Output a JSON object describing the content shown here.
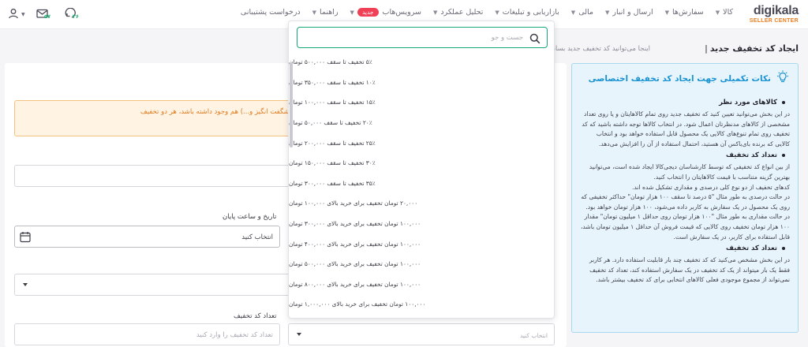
{
  "brand": {
    "name": "digikala",
    "sub": "SELLER CENTER"
  },
  "nav": [
    {
      "label": "کالا",
      "has_menu": true
    },
    {
      "label": "سفارش‌ها",
      "has_menu": true
    },
    {
      "label": "ارسال و انبار",
      "has_menu": true
    },
    {
      "label": "مالی",
      "has_menu": true
    },
    {
      "label": "بازاریابی و تبلیغات",
      "has_menu": true
    },
    {
      "label": "تحلیل عملکرد",
      "has_menu": true
    },
    {
      "label": "سرویس‌هاب",
      "has_menu": true,
      "badge": "جدید"
    },
    {
      "label": "راهنما",
      "has_menu": true
    },
    {
      "label": "درخواست پشتیبانی",
      "has_menu": false
    }
  ],
  "top_icons": {
    "messages_count": "۵۷",
    "notifications_count": "۲۶"
  },
  "page": {
    "title": "ایجاد کد تخفیف جدید",
    "separator": "|",
    "subtitle": "اینجا می‌توانید کد تخفیف جدید بسازید."
  },
  "tips": {
    "title": "نکات تکمیلی جهت ایجاد کد تخفیف اختصاصی",
    "sections": [
      {
        "heading": "کالاهای مورد نظر",
        "paragraphs": [
          "در این بخش می‌توانید تعیین کنید که تخفیف جدید روی تمام کالاهایتان و یا روی تعداد مشخصی از کالاهای مدنظرتان اعمال شود. در انتخاب کالاها توجه داشته باشید که کد تخفیف روی تمام تنوع‌های کالایی یک محصول قابل استفاده خواهد بود و انتخاب کالایی که برنده بای‌باکس آن هستید، احتمال استفاده از آن را افزایش می‌دهد."
        ]
      },
      {
        "heading": "تعداد کد تخفیف",
        "paragraphs": [
          "از بین انواع کد تخفیفی که توسط کارشناسان دیجی‌کالا ایجاد شده است، می‌توانید بهترین گزینه متناسب با قیمت کالاهایتان را انتخاب کنید.",
          "کدهای تخفیف از دو نوع کلی درصدی و مقداری تشکیل شده اند.",
          "در حالت درصدی به طور مثال \"۵ درصد تا سقف ۱۰۰ هزار تومان\" حداکثر تخفیفی که روی یک محصول در یک سفارش به کاربر داده می‌شود، ۱۰۰ هزار تومان خواهد بود.",
          "در حالت مقداری به طور مثال \"۱۰۰ هزار تومان روی حداقل ۱ میلیون تومان\" مقدار ۱۰۰ هزار تومان تخفیف روی کالایی که قیمت فروش آن حداقل ۱ میلیون تومان باشد، قابل استفاده برای کاربر، در یک سفارش است."
        ]
      },
      {
        "heading": "تعداد کد تخفیف",
        "paragraphs": [
          "در این بخش مشخص می‌کنید که کد تخفیف چند بار قابلیت استفاده دارد. هر کاربر فقط یک بار میتواند از یک کد تخفیف در یک سفارش استفاده کند، تعداد کد تخفیف نمی‌تواند از مجموع موجودی فعلی کالاهای انتخابی برای کد تخفیف بیشتر باشد."
        ]
      }
    ]
  },
  "form": {
    "alert_text": "در صورتی که کالاهای انتخابی شما در کمپین تخفیف دیگری (هوشمند، کمپین، شگفت انگیز و...) هم وجود داشته باشد، هر دو تخفیف",
    "end_datetime_label": "تاریخ و ساعت پایان",
    "end_datetime_value": "انتخاب کنید",
    "count_label": "تعداد کد تخفیف",
    "count_placeholder": "تعداد کد تخفیف را وارد کنید",
    "select_placeholder": "انتخاب کنید"
  },
  "dropdown": {
    "search_placeholder": "جست و جو",
    "options": [
      "۵٪ تخفیف تا سقف ۵۰۰,۰۰۰ تومان",
      "۱۰٪ تخفیف تا سقف ۳۵۰,۰۰۰ تومان",
      "۱۵٪ تخفیف تا سقف ۱۰۰,۰۰۰ تومان",
      "۲۰٪ تخفیف تا سقف ۵۰,۰۰۰ تومان",
      "۲۵٪ تخفیف تا سقف ۲۰۰,۰۰۰ تومان",
      "۳۰٪ تخفیف تا سقف ۱۵۰,۰۰۰ تومان",
      "۳۵٪ تخفیف تا سقف ۳۰۰,۰۰۰ تومان",
      "۲۰,۰۰۰ تومان تخفیف برای خرید بالای ۱۰۰,۰۰۰ تومان",
      "۱۰۰,۰۰۰ تومان تخفیف برای خرید بالای ۳۰۰,۰۰۰ تومان",
      "۱۰۰,۰۰۰ تومان تخفیف برای خرید بالای ۴۰۰,۰۰۰ تومان",
      "۱۰۰,۰۰۰ تومان تخفیف برای خرید بالای ۵۰۰,۰۰۰ تومان",
      "۱۰۰,۰۰۰ تومان تخفیف برای خرید بالای ۸۰۰,۰۰۰ تومان",
      "۱۰۰,۰۰۰ تومان تخفیف برای خرید بالای ۱,۰۰۰,۰۰۰ تومان"
    ]
  },
  "colors": {
    "accent": "#19a77a",
    "brand_orange": "#ef7d1e",
    "info_blue": "#1a93d2",
    "badge_red": "#ef4056"
  },
  "icons": [
    "user-icon",
    "messages-icon",
    "notifications-icon",
    "lightbulb-icon",
    "calendar-icon",
    "search-icon",
    "chevron-down-icon"
  ]
}
